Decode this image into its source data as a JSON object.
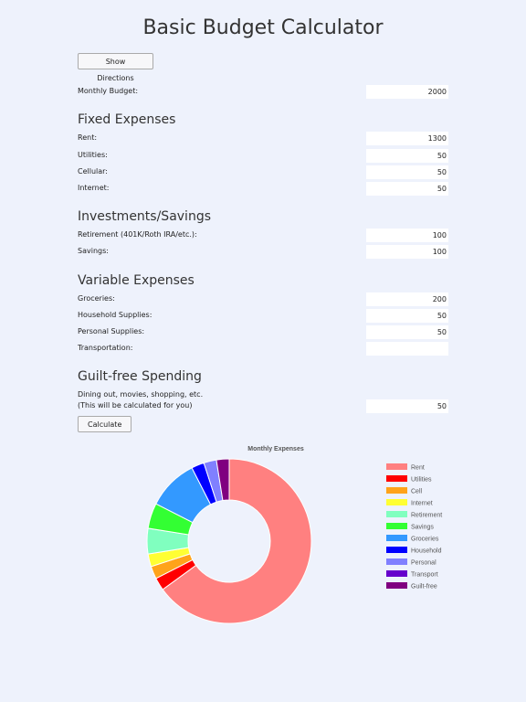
{
  "page": {
    "title": "Basic Budget Calculator"
  },
  "buttons": {
    "show_directions": "Show Directions",
    "calculate": "Calculate"
  },
  "budget": {
    "label": "Monthly Budget:",
    "value": "2000"
  },
  "fixed": {
    "heading": "Fixed Expenses",
    "rent": {
      "label": "Rent:",
      "value": "1300"
    },
    "utilities": {
      "label": "Utilities:",
      "value": "50"
    },
    "cellular": {
      "label": "Cellular:",
      "value": "50"
    },
    "internet": {
      "label": "Internet:",
      "value": "50"
    }
  },
  "investments": {
    "heading": "Investments/Savings",
    "retirement": {
      "label": "Retirement (401K/Roth IRA/etc.):",
      "value": "100"
    },
    "savings": {
      "label": "Savings:",
      "value": "100"
    }
  },
  "variable": {
    "heading": "Variable Expenses",
    "groceries": {
      "label": "Groceries:",
      "value": "200"
    },
    "household": {
      "label": "Household Supplies:",
      "value": "50"
    },
    "personal": {
      "label": "Personal Supplies:",
      "value": "50"
    },
    "transportation": {
      "label": "Transportation:",
      "value": ""
    }
  },
  "guilt": {
    "heading": "Guilt-free Spending",
    "line1": "Dining out, movies, shopping, etc.",
    "line2": "(This will be calculated for you)",
    "value": "50"
  },
  "chart_data": {
    "type": "pie",
    "title": "Monthly Expenses",
    "categories": [
      "Rent",
      "Utilities",
      "Cell",
      "Internet",
      "Retirement",
      "Savings",
      "Groceries",
      "Household",
      "Personal",
      "Transport",
      "Guilt-free"
    ],
    "values": [
      1300,
      50,
      50,
      50,
      100,
      100,
      200,
      50,
      50,
      0,
      50
    ],
    "colors": [
      "#ff8080",
      "#ff0000",
      "#ffa31a",
      "#ffff33",
      "#80ffbf",
      "#33ff33",
      "#3399ff",
      "#0000ff",
      "#8080ff",
      "#6600cc",
      "#800080"
    ],
    "legend": "right",
    "donut": true
  }
}
